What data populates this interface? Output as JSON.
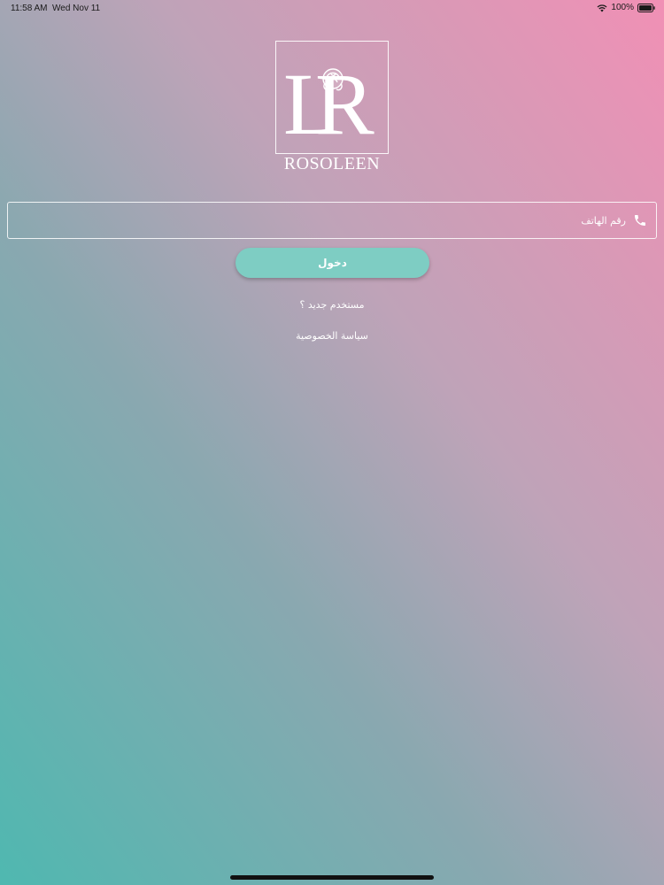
{
  "status_bar": {
    "time": "11:58 AM",
    "date": "Wed Nov 11",
    "battery_percent": "100%",
    "battery_level": 1.0
  },
  "logo": {
    "brand_name": "ROSOLEEN"
  },
  "login_form": {
    "phone_placeholder": "رقم الهاتف",
    "phone_value": "",
    "phone_icon": "phone-icon",
    "login_label": "دخول"
  },
  "links": {
    "new_user": "مستخدم جديد ؟",
    "privacy_policy": "سياسة الخصوصية"
  },
  "colors": {
    "gradient_pink": "#f190b5",
    "gradient_teal": "#4fb8b0",
    "button_teal": "#7ecdc3"
  }
}
